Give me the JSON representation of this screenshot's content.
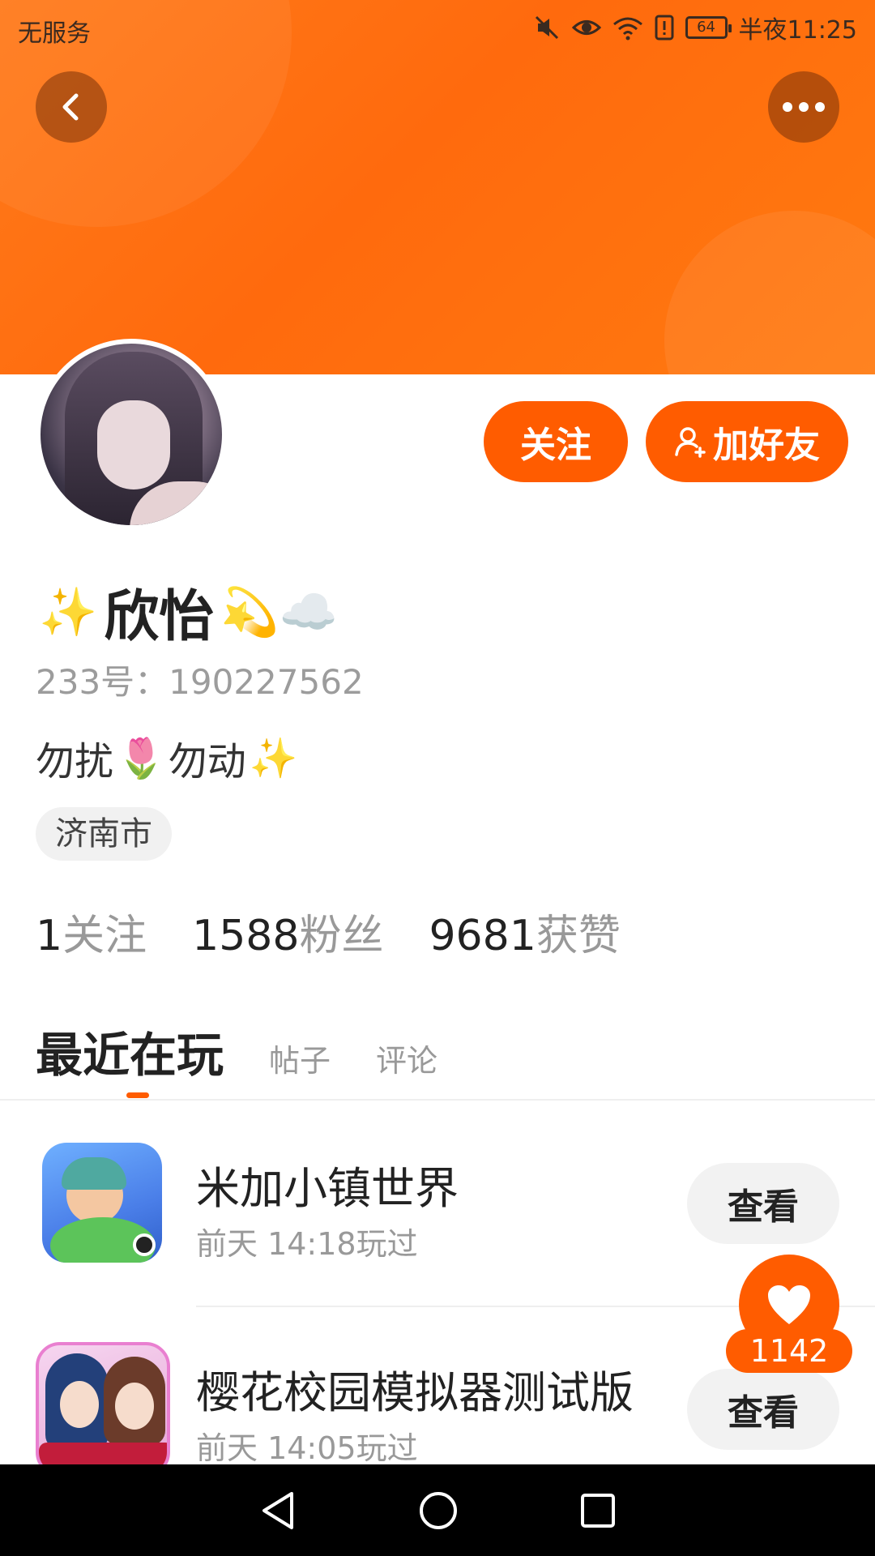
{
  "status_bar": {
    "carrier": "无服务",
    "battery": "64",
    "time": "半夜11:25"
  },
  "profile": {
    "nickname": "欣怡",
    "nickname_emojis_before": "✨",
    "nickname_emojis_after": "💫☁️",
    "id_label": "233号：",
    "id_value": "190227562",
    "bio_part1": "勿扰",
    "bio_emoji1": "🌷",
    "bio_part2": "勿动",
    "bio_emoji2": "✨",
    "location": "济南市"
  },
  "actions": {
    "follow_label": "关注",
    "add_friend_label": "加好友"
  },
  "stats": [
    {
      "value": "1",
      "label": "关注"
    },
    {
      "value": "1588",
      "label": "粉丝"
    },
    {
      "value": "9681",
      "label": "获赞"
    }
  ],
  "tabs": {
    "active": "最近在玩",
    "others": [
      "帖子",
      "评论"
    ]
  },
  "games": [
    {
      "title": "米加小镇世界",
      "time": "前天 14:18玩过",
      "button": "查看"
    },
    {
      "title": "樱花校园模拟器测试版",
      "time": "前天 14:05玩过",
      "button": "查看"
    }
  ],
  "like": {
    "count": "1142"
  },
  "colors": {
    "accent": "#ff5c00",
    "header": "#ff7a1a"
  }
}
